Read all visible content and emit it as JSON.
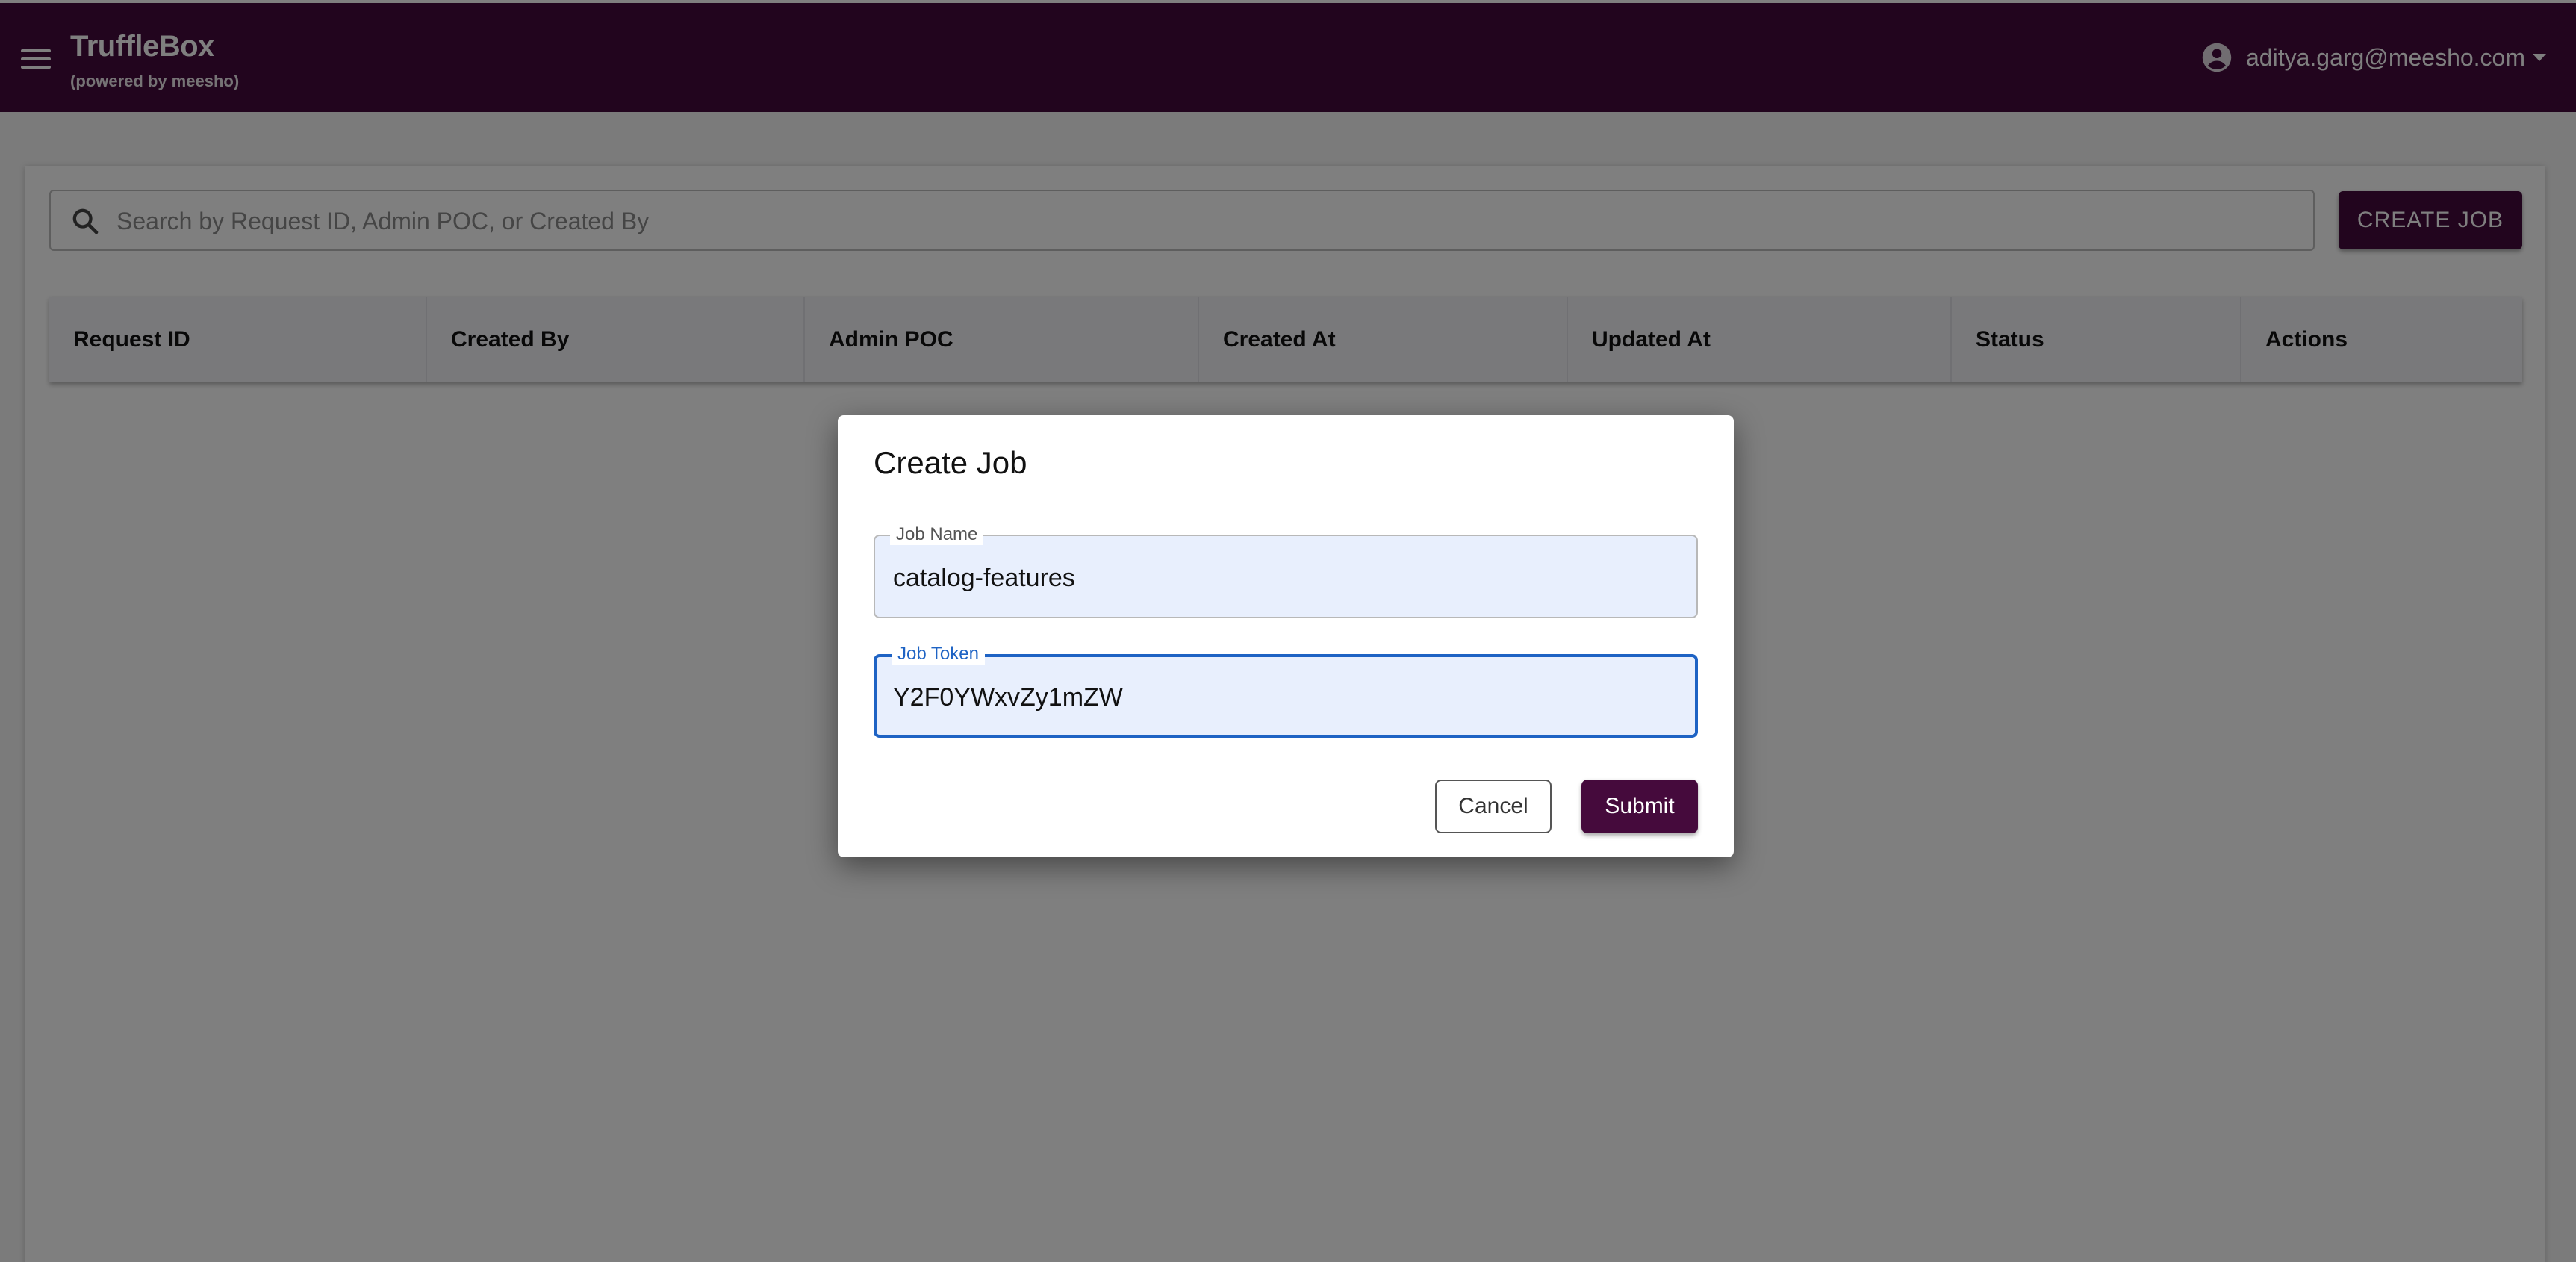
{
  "appbar": {
    "title": "TruffleBox",
    "subtitle": "(powered by meesho)",
    "user_email": "aditya.garg@meesho.com",
    "menu_icon": "menu-icon",
    "user_icon": "account-circle-icon",
    "caret_icon": "caret-down-icon",
    "color": "#450a3c"
  },
  "toolbar": {
    "search_placeholder": "Search by Request ID, Admin POC, or Created By",
    "search_value": "",
    "search_icon": "search-icon",
    "create_job_label": "CREATE JOB"
  },
  "table": {
    "columns": [
      "Request ID",
      "Created By",
      "Admin POC",
      "Created At",
      "Updated At",
      "Status",
      "Actions"
    ],
    "rows": []
  },
  "dialog": {
    "title": "Create Job",
    "job_name_label": "Job Name",
    "job_name_value": "catalog-features",
    "job_token_label": "Job Token",
    "job_token_value": "Y2F0YWxvZy1mZW",
    "cancel_label": "Cancel",
    "submit_label": "Submit",
    "focus_color": "#1e63c4"
  }
}
